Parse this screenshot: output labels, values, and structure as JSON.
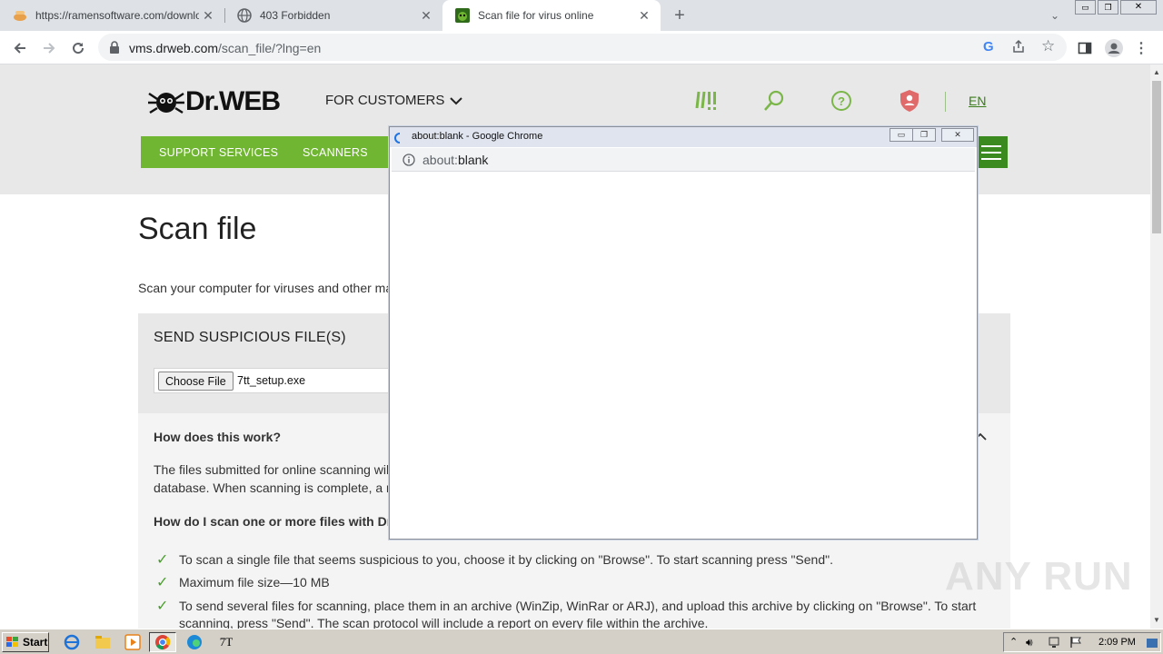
{
  "browser": {
    "tabs": [
      {
        "title": "https://ramensoftware.com/downlo",
        "active": false
      },
      {
        "title": "403 Forbidden",
        "active": false
      },
      {
        "title": "Scan file for virus online",
        "active": true
      }
    ],
    "url_host": "vms.drweb.com",
    "url_path": "/scan_file/?lng=en"
  },
  "site": {
    "logo_text": "Dr.WEB",
    "menu_label": "FOR CUSTOMERS",
    "lang": "EN",
    "nav": [
      "SUPPORT SERVICES",
      "SCANNERS"
    ],
    "page_title": "Scan file",
    "intro": "Scan your computer for viruses and other malicious software",
    "send_title": "SEND SUSPICIOUS FILE(S)",
    "choose_file_label": "Choose File",
    "chosen_file": "7tt_setup.exe",
    "how_question": "How does this work?",
    "how_line1": "The files submitted for online scanning will be checked",
    "how_line2": "database. When scanning is complete, a report",
    "how_question2": "How do I scan one or more files with Dr.Web online",
    "bullets": [
      "To scan a single file that seems suspicious to you, choose it by clicking on \"Browse\". To start scanning press \"Send\".",
      "Maximum file size—10 MB",
      "To send several files for scanning, place them in an archive (WinZip, WinRar or ARJ), and upload this archive by clicking on \"Browse\". To start",
      "scanning, press \"Send\". The scan protocol will include a report on every file within the archive."
    ]
  },
  "popup": {
    "title": "about:blank - Google Chrome",
    "url_prefix": "about:",
    "url_rest": "blank"
  },
  "taskbar": {
    "start_label": "Start",
    "clock": "2:09 PM"
  },
  "watermark": "ANY RUN",
  "colors": {
    "brand_green": "#71b633",
    "dark_green": "#3a8a1f"
  }
}
